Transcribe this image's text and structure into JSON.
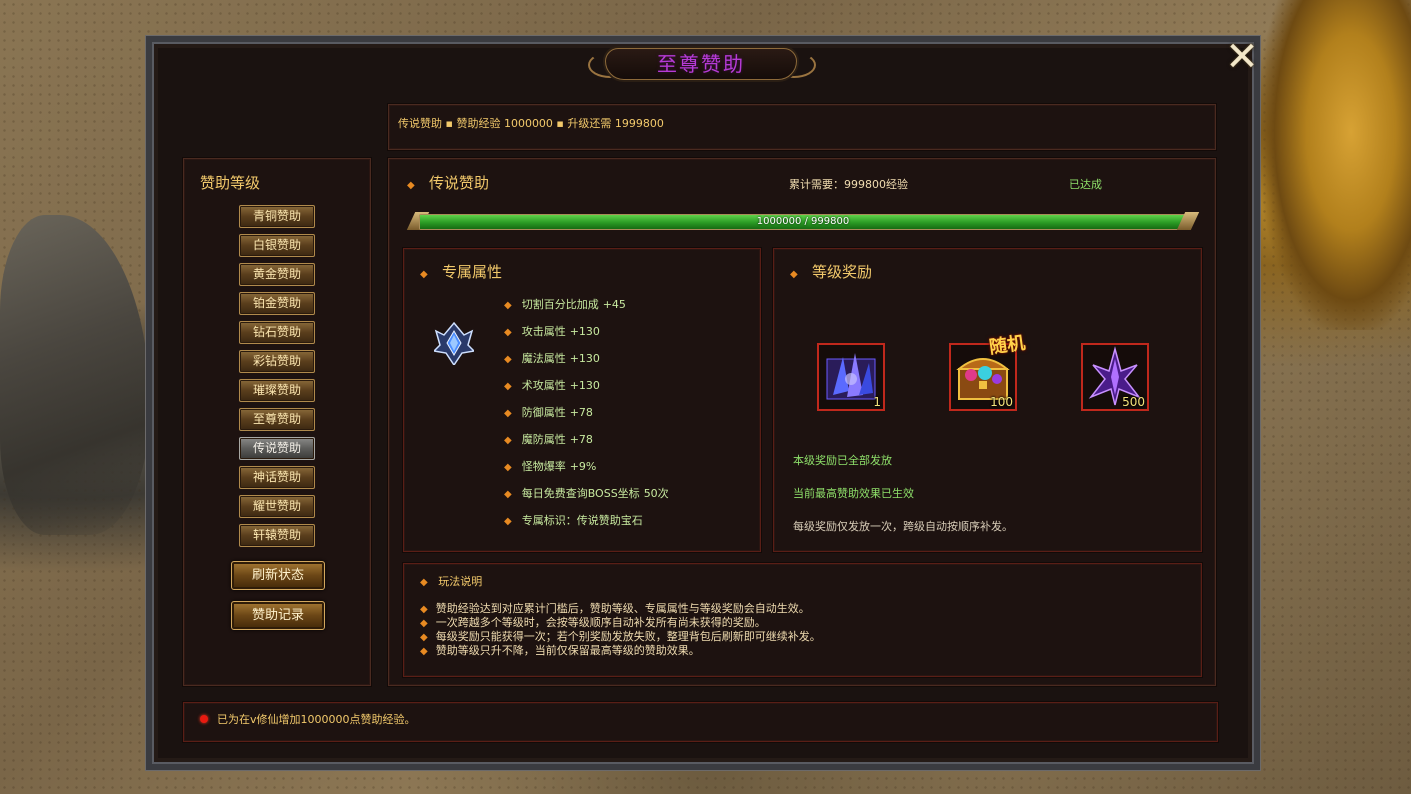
{
  "window": {
    "title": "至尊赞助",
    "close_icon": "✕"
  },
  "info_bar": "传说赞助 ▪ 赞助经验 1000000 ▪ 升级还需 1999800",
  "sidebar": {
    "heading": "赞助等级",
    "levels": [
      {
        "label": "青铜赞助",
        "active": false
      },
      {
        "label": "白银赞助",
        "active": false
      },
      {
        "label": "黄金赞助",
        "active": false
      },
      {
        "label": "铂金赞助",
        "active": false
      },
      {
        "label": "钻石赞助",
        "active": false
      },
      {
        "label": "彩钻赞助",
        "active": false
      },
      {
        "label": "璀璨赞助",
        "active": false
      },
      {
        "label": "至尊赞助",
        "active": false
      },
      {
        "label": "传说赞助",
        "active": true
      },
      {
        "label": "神话赞助",
        "active": false
      },
      {
        "label": "耀世赞助",
        "active": false
      },
      {
        "label": "轩辕赞助",
        "active": false
      }
    ],
    "refresh_button": "刷新状态",
    "record_button": "赞助记录"
  },
  "main": {
    "level_title": "传说赞助",
    "requirement": "累计需要：999800经验",
    "status": "已达成",
    "progress_text": "1000000 / 999800",
    "progress_fraction": 1.0
  },
  "attributes": {
    "title": "专属属性",
    "icon": "blue-crystal-gem-icon",
    "items": [
      {
        "name": "切割百分比加成",
        "value": "+45"
      },
      {
        "name": "攻击属性",
        "value": "+130"
      },
      {
        "name": "魔法属性",
        "value": "+130"
      },
      {
        "name": "术攻属性",
        "value": "+130"
      },
      {
        "name": "防御属性",
        "value": "+78"
      },
      {
        "name": "魔防属性",
        "value": "+78"
      },
      {
        "name": "怪物爆率",
        "value": "+9%"
      },
      {
        "name": "每日免费查询BOSS坐标",
        "value": "50次"
      },
      {
        "name": "专属标识：传说赞助宝石",
        "value": ""
      }
    ]
  },
  "rewards": {
    "title": "等级奖励",
    "random_tag": "随机",
    "items": [
      {
        "icon": "purple-crystal-box-icon",
        "count": "1"
      },
      {
        "icon": "golden-treasure-chest-icon",
        "count": "100"
      },
      {
        "icon": "purple-crystal-shard-icon",
        "count": "500"
      }
    ],
    "notes": [
      {
        "text": "本级奖励已全部发放",
        "color": "#8ee06a"
      },
      {
        "text": "当前最高赞助效果已生效",
        "color": "#8ee06a"
      },
      {
        "text": "每级奖励仅发放一次，跨级自动按顺序补发。",
        "color": "#d8cdb8"
      }
    ]
  },
  "help": {
    "title": "玩法说明",
    "lines": [
      "赞助经验达到对应累计门槛后，赞助等级、专属属性与等级奖励会自动生效。",
      "一次跨越多个等级时，会按等级顺序自动补发所有尚未获得的奖励。",
      "每级奖励只能获得一次；若个别奖励发放失败，整理背包后刷新即可继续补发。",
      "赞助等级只升不降，当前仅保留最高等级的赞助效果。"
    ]
  },
  "status_bar": {
    "message": "已为在v修仙增加1000000点赞助经验。"
  },
  "colors": {
    "accent_gold": "#f2c96b",
    "positive_green": "#8ee06a",
    "title_purple": "#b63bd6",
    "progress_green": "#2a9a24"
  }
}
